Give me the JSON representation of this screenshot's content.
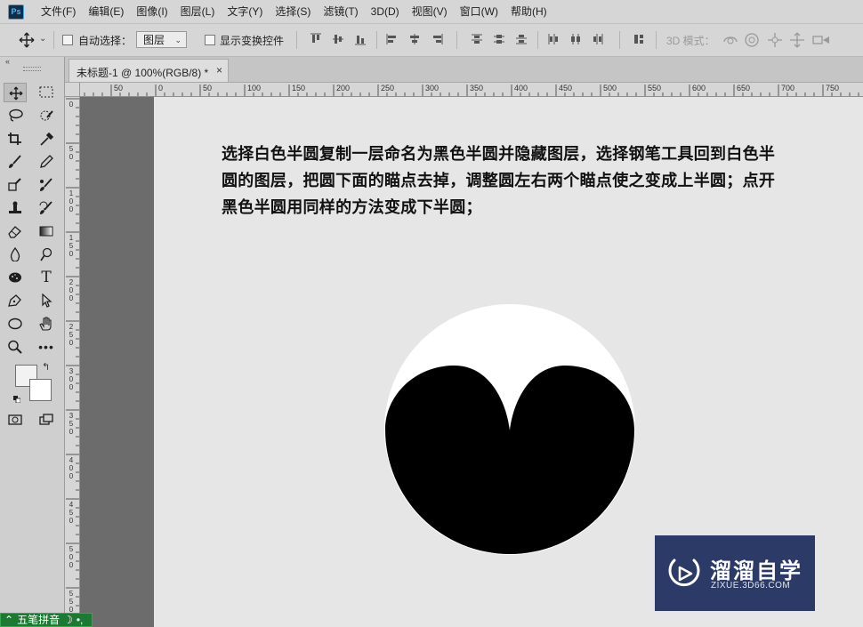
{
  "app": {
    "logo": "Ps"
  },
  "menu": [
    "文件(F)",
    "编辑(E)",
    "图像(I)",
    "图层(L)",
    "文字(Y)",
    "选择(S)",
    "滤镜(T)",
    "3D(D)",
    "视图(V)",
    "窗口(W)",
    "帮助(H)"
  ],
  "options": {
    "auto_select_label": "自动选择：",
    "auto_select_target": "图层",
    "show_transform_label": "显示变换控件",
    "mode_3d_label": "3D 模式："
  },
  "document": {
    "tab_title": "未标题-1 @ 100%(RGB/8) *",
    "close": "×"
  },
  "rulers": {
    "horizontal": [
      "50",
      "0",
      "50",
      "100",
      "150",
      "200",
      "250",
      "300",
      "350",
      "400",
      "450",
      "500",
      "550",
      "600",
      "650",
      "700",
      "750"
    ],
    "vertical": [
      "0",
      "5\n0",
      "1\n0\n0",
      "1\n5\n0",
      "2\n0\n0",
      "2\n5\n0",
      "3\n0\n0",
      "3\n5\n0",
      "4\n0\n0",
      "4\n5\n0",
      "5\n0\n0",
      "5\n5\n0"
    ]
  },
  "canvas": {
    "instruction": "选择白色半圆复制一层命名为黑色半圆并隐藏图层，选择钢笔工具回到白色半圆的图层，把圆下面的瞄点去掉，调整圆左右两个瞄点使之变成上半圆；点开黑色半圆用同样的方法变成下半圆；",
    "colors": {
      "background": "#e6e6e6",
      "white_shape": "#ffffff",
      "black_shape": "#000000"
    }
  },
  "watermark": {
    "brand": "溜溜自学",
    "url": "ZIXUE.3D66.COM"
  },
  "ime": {
    "label": "五笔拼音"
  },
  "swatches": {
    "foreground": "#f2f2f2",
    "background": "#ffffff"
  },
  "tools": [
    "move-icon",
    "marquee-icon",
    "lasso-icon",
    "quick-select-icon",
    "crop-icon",
    "eyedropper-icon",
    "healing-brush-icon",
    "brush-icon",
    "clone-stamp-icon",
    "history-brush-icon",
    "eraser-icon",
    "gradient-icon",
    "blur-icon",
    "dodge-icon",
    "sponge-icon",
    "type-icon",
    "pen-icon",
    "path-select-icon",
    "ellipse-icon",
    "hand-icon",
    "zoom-icon",
    "more-icon",
    "quick-mask-icon",
    "screen-mode-icon"
  ]
}
